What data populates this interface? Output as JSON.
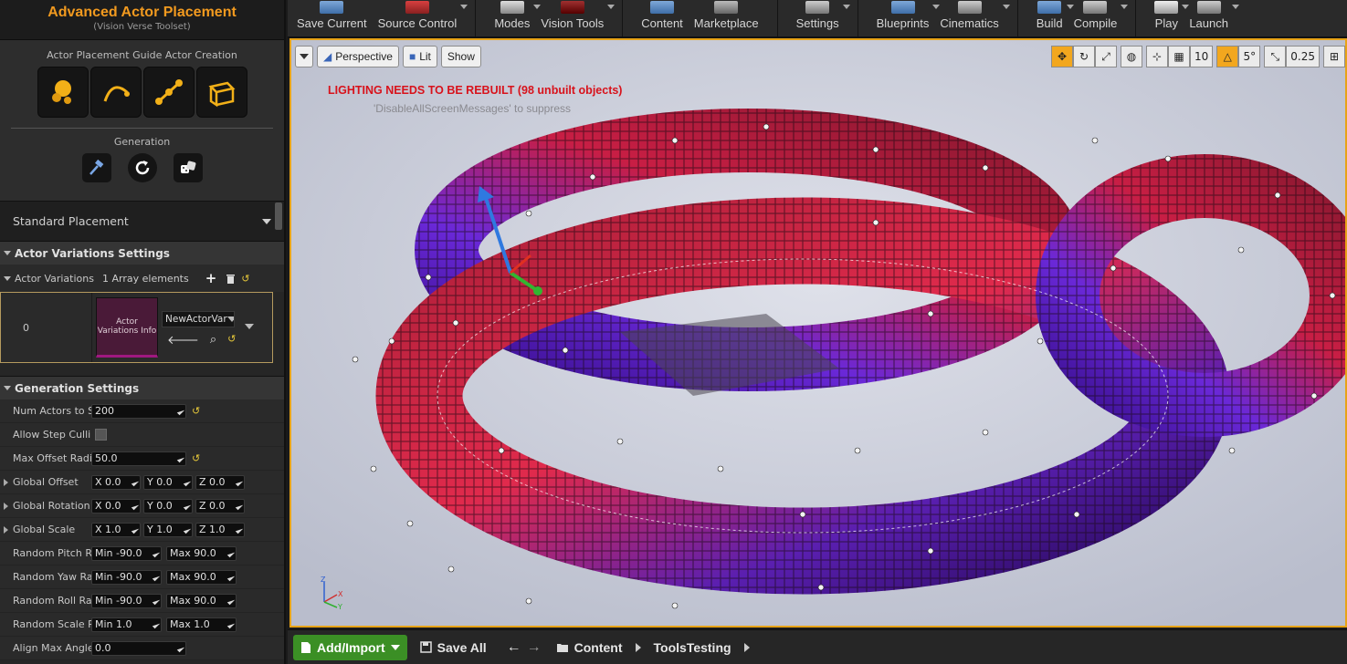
{
  "panel": {
    "title": "Advanced Actor Placement",
    "subtitle": "(Vision Verse Toolset)",
    "guide_caption": "Actor Placement Guide Actor Creation",
    "guide_buttons": [
      "sphere-actor-icon",
      "spline-actor-icon",
      "line-actor-icon",
      "box-actor-icon"
    ],
    "generation_caption": "Generation",
    "generation_buttons": [
      "hammer-icon",
      "refresh-icon",
      "dice-icon"
    ],
    "placement_mode": "Standard Placement"
  },
  "actor_variations": {
    "header": "Actor Variations Settings",
    "label": "Actor Variations",
    "count_text": "1 Array elements",
    "element_index": "0",
    "element_thumb": "Actor Variations Info",
    "element_value": "NewActorVar"
  },
  "generation": {
    "header": "Generation Settings",
    "num_actors_label": "Num Actors to S",
    "num_actors": "200",
    "allow_step_label": "Allow Step Cullin",
    "max_offset_label": "Max Offset Radi",
    "max_offset": "50.0",
    "global_offset_label": "Global Offset",
    "global_offset": {
      "x": "0.0",
      "y": "0.0",
      "z": "0.0"
    },
    "global_rotation_label": "Global Rotation",
    "global_rotation": {
      "x": "0.0",
      "y": "0.0",
      "z": "0.0"
    },
    "global_scale_label": "Global Scale",
    "global_scale": {
      "x": "1.0",
      "y": "1.0",
      "z": "1.0"
    },
    "pitch_label": "Random Pitch Ra",
    "pitch": {
      "min": "-90.0",
      "max": "90.0"
    },
    "yaw_label": "Random Yaw Ra",
    "yaw": {
      "min": "-90.0",
      "max": "90.0"
    },
    "roll_label": "Random Roll Rar",
    "roll": {
      "min": "-90.0",
      "max": "90.0"
    },
    "scale_label": "Random Scale R",
    "scale": {
      "min": "1.0",
      "max": "1.0"
    },
    "align_label": "Align Max Angle",
    "align": "0.0"
  },
  "toolbar": {
    "items": [
      "Save Current",
      "Source Control",
      "Modes",
      "Vision Tools",
      "Content",
      "Marketplace",
      "Settings",
      "Blueprints",
      "Cinematics",
      "Build",
      "Compile",
      "Play",
      "Launch"
    ]
  },
  "viewport": {
    "perspective": "Perspective",
    "lit": "Lit",
    "show": "Show",
    "grid_snap": "10",
    "rot_snap": "5°",
    "scale_snap": "0.25",
    "warning": "LIGHTING NEEDS TO BE REBUILT (98 unbuilt objects)",
    "warning_hint": "'DisableAllScreenMessages' to suppress"
  },
  "content_bar": {
    "add_import": "Add/Import",
    "save_all": "Save All",
    "crumb_root": "Content",
    "crumb_folder": "ToolsTesting"
  },
  "colors": {
    "accent": "#f29a1f",
    "warning": "#d8121b",
    "add_button": "#3b8f25"
  }
}
